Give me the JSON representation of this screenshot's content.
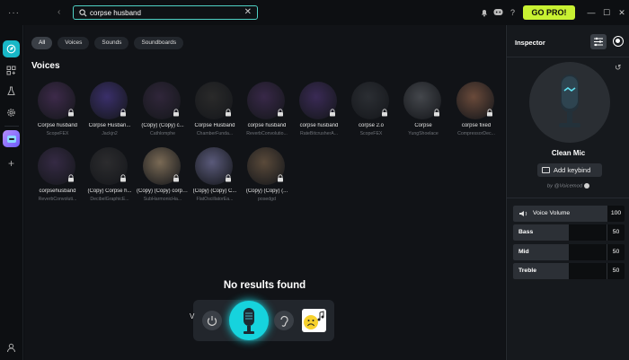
{
  "titlebar": {
    "menu_glyph": "···",
    "back_glyph": "‹",
    "search_value": "corpse husband",
    "clear_glyph": "✕",
    "help_glyph": "?",
    "gopro_label": "GO PRO!",
    "minimize_glyph": "—",
    "maximize_glyph": "☐",
    "close_glyph": "✕"
  },
  "filters": [
    "All",
    "Voices",
    "Sounds",
    "Soundboards"
  ],
  "section_title": "Voices",
  "voices": [
    {
      "name": "Corpse husband",
      "sub": "ScopeFEX",
      "color": "#3d2a4a"
    },
    {
      "name": "Corpse Husban...",
      "sub": "Jackjn2",
      "color": "#3a2f6a"
    },
    {
      "name": "(Copy) (Copy) c...",
      "sub": "Cathlomphe",
      "color": "#30263a"
    },
    {
      "name": "Corpse Husband",
      "sub": "ChamberFunda...",
      "color": "#2a2a2a"
    },
    {
      "name": "corpse husband",
      "sub": "ReverbConvolutio...",
      "color": "#382848"
    },
    {
      "name": "corpse husband",
      "sub": "RateBitcrusherA...",
      "color": "#3a2a55"
    },
    {
      "name": "corpse 2.o",
      "sub": "ScopeFEX",
      "color": "#2b2e33"
    },
    {
      "name": "Corpse",
      "sub": "YungShoelace",
      "color": "#44474c"
    },
    {
      "name": "corpse fixed",
      "sub": "CompressorDec...",
      "color": "#6a4a3a"
    },
    {
      "name": "corpsehusband",
      "sub": "ReverbConvoluti...",
      "color": "#352a44"
    },
    {
      "name": "(Copy) Corpse h...",
      "sub": "DecibelGraphicE...",
      "color": "#2c2c2e"
    },
    {
      "name": "(Copy) (Copy) corpse h...",
      "sub": "SubHarmonicHa...",
      "color": "#7a6a55"
    },
    {
      "name": "(Copy) (Copy) C...",
      "sub": "FlatOscillatorEa...",
      "color": "#5a5a7a"
    },
    {
      "name": "(Copy) (Copy) (...",
      "sub": "posedgd",
      "color": "#5a4a3a"
    }
  ],
  "no_results": "No results found",
  "bottom_bar_initial": "V",
  "inspector": {
    "title": "Inspector",
    "voice_name": "Clean Mic",
    "keybind_label": "Add keybind",
    "author": "by @Voicemod",
    "sliders": [
      {
        "label": "Voice Volume",
        "value": "100",
        "fill": 1.0
      },
      {
        "label": "Bass",
        "value": "50",
        "fill": 0.5
      },
      {
        "label": "Mid",
        "value": "50",
        "fill": 0.5
      },
      {
        "label": "Treble",
        "value": "50",
        "fill": 0.5
      }
    ]
  },
  "colors": {
    "accent": "#18b7c7",
    "gopro": "#c8f132",
    "search_border": "#4fd1c5"
  }
}
